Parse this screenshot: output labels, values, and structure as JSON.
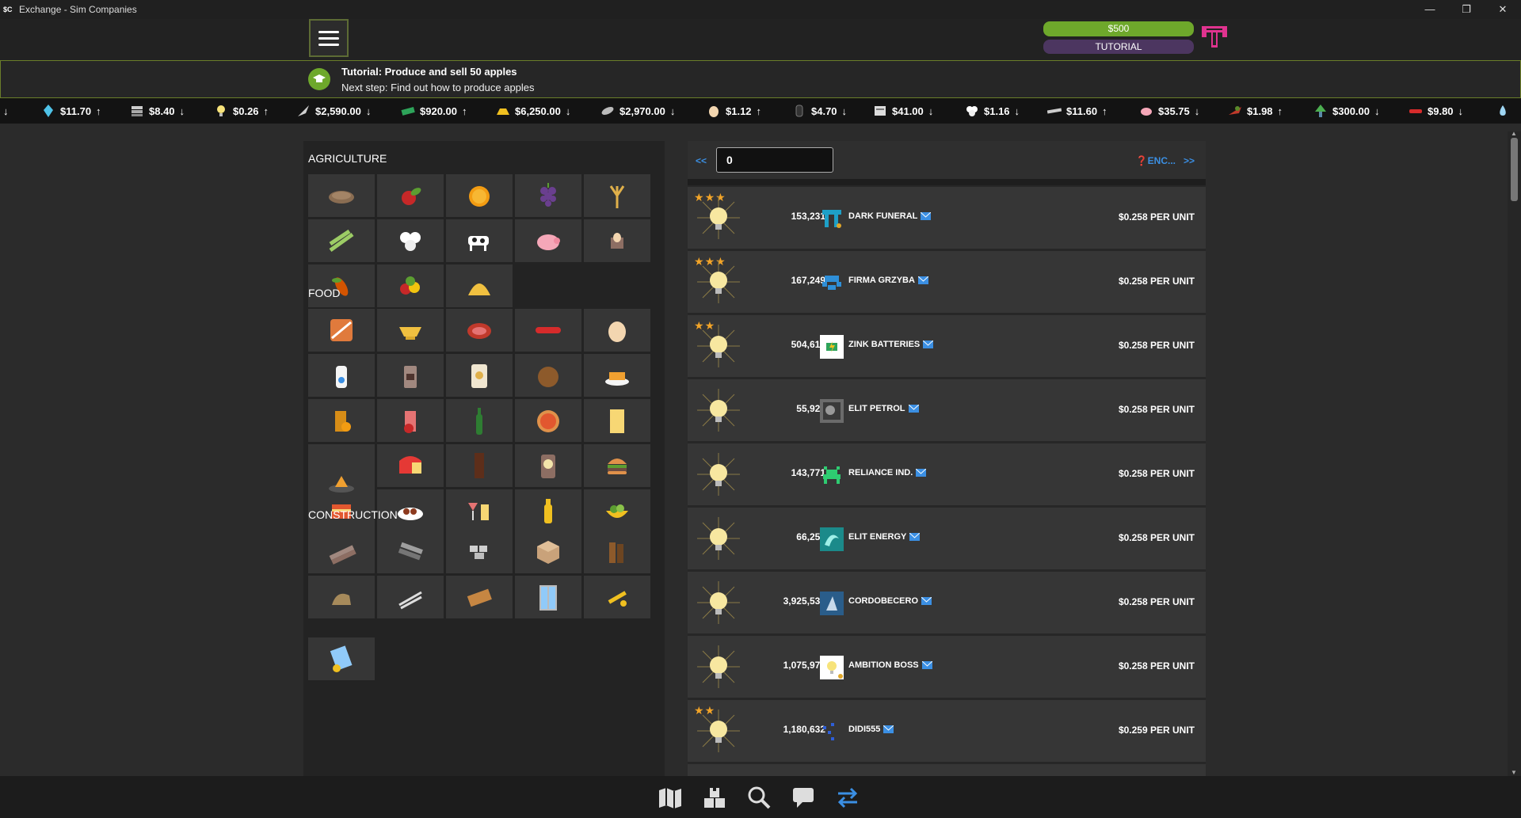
{
  "window": {
    "app_icon": "$C",
    "title": "Exchange - Sim Companies",
    "controls": [
      "—",
      "❐",
      "✕"
    ]
  },
  "header": {
    "money": "$500",
    "tutorial_label": "TUTORIAL",
    "logo": "company-logo-pink-T"
  },
  "tutorial": {
    "title": "Tutorial: Produce and sell 50 apples",
    "step": "Next step: Find out how to produce apples"
  },
  "ticker": [
    {
      "icon": "arrow",
      "price": "",
      "dir": "↓"
    },
    {
      "icon": "crystal-icon",
      "price": "$11.70",
      "dir": "↑"
    },
    {
      "icon": "silicon-icon",
      "price": "$8.40",
      "dir": "↓"
    },
    {
      "icon": "power-icon",
      "price": "$0.26",
      "dir": "↑"
    },
    {
      "icon": "rocket-icon",
      "price": "$2,590.00",
      "dir": "↓"
    },
    {
      "icon": "cash-icon",
      "price": "$920.00",
      "dir": "↑"
    },
    {
      "icon": "gold-icon",
      "price": "$6,250.00",
      "dir": "↓"
    },
    {
      "icon": "jet-icon",
      "price": "$2,970.00",
      "dir": "↓"
    },
    {
      "icon": "egg-icon",
      "price": "$1.12",
      "dir": "↑"
    },
    {
      "icon": "seeds-icon",
      "price": "$4.70",
      "dir": "↓"
    },
    {
      "icon": "box-icon",
      "price": "$41.00",
      "dir": "↓"
    },
    {
      "icon": "cotton-icon",
      "price": "$1.16",
      "dir": "↓"
    },
    {
      "icon": "steel-icon",
      "price": "$11.60",
      "dir": "↑"
    },
    {
      "icon": "pig-icon",
      "price": "$35.75",
      "dir": "↓"
    },
    {
      "icon": "plane-icon",
      "price": "$1.98",
      "dir": "↑"
    },
    {
      "icon": "tree-icon",
      "price": "$300.00",
      "dir": "↓"
    },
    {
      "icon": "sausage-icon",
      "price": "$9.80",
      "dir": "↓"
    },
    {
      "icon": "water-icon",
      "price": "",
      "dir": ""
    }
  ],
  "categories": [
    {
      "name": "AGRICULTURE",
      "items": [
        "seeds-icon",
        "apple-icon",
        "orange-icon",
        "grapes-icon",
        "wheat-icon",
        "sugarcane-icon",
        "cotton-icon",
        "cow-icon",
        "pig-icon",
        "eggs-icon",
        "cocoa-icon",
        "vegetables-icon",
        "straw-icon"
      ]
    },
    {
      "name": "FOOD",
      "items": [
        "bread-icon",
        "sauce-icon",
        "steak-icon",
        "sausages-icon",
        "egg-icon",
        "milk-icon",
        "coffee-icon",
        "flour-icon",
        "pie-icon",
        "fries-icon",
        "orange-juice-icon",
        "apple-juice-icon",
        "ginger-beer-icon",
        "pizza-icon",
        "juice-box-icon",
        "butter-icon",
        "cheese-icon",
        "chocolate-icon",
        "coffee-beans-icon",
        "burger-icon",
        "lasagna-icon",
        "meatballs-icon",
        "cocktails-icon",
        "cooking-oil-icon",
        "salad-icon",
        "samosa-icon"
      ]
    },
    {
      "name": "CONSTRUCTION",
      "items": [
        "planks-icon",
        "steel-bars-icon",
        "bricks-icon",
        "cement-icon",
        "wood-icon",
        "clay-icon",
        "reinforced-concrete-icon",
        "board-icon",
        "windows-icon",
        "tools-icon",
        "glass-icon"
      ]
    }
  ],
  "market": {
    "prev_label": "<<",
    "next_label": ">>",
    "qty_value": "0",
    "enc_label": "ENC...",
    "listings": [
      {
        "stars": 3,
        "qty": "153,231",
        "company": "DARK FUNERAL",
        "logo": "teal-tt-logo",
        "price": "$0.258 PER UNIT"
      },
      {
        "stars": 3,
        "qty": "167,249",
        "company": "FIRMA GRZYBA",
        "logo": "blue-pixel-logo",
        "price": "$0.258 PER UNIT"
      },
      {
        "stars": 2,
        "qty": "504,614",
        "company": "ZINK BATTERIES",
        "logo": "battery-logo",
        "price": "$0.258 PER UNIT"
      },
      {
        "stars": 0,
        "qty": "55,926",
        "company": "ELIT PETROL",
        "logo": "photo-logo",
        "price": "$0.258 PER UNIT"
      },
      {
        "stars": 0,
        "qty": "143,771",
        "company": "RELIANCE IND.",
        "logo": "green-invader-logo",
        "price": "$0.258 PER UNIT"
      },
      {
        "stars": 0,
        "qty": "66,256",
        "company": "ELIT ENERGY",
        "logo": "wave-logo",
        "price": "$0.258 PER UNIT"
      },
      {
        "stars": 0,
        "qty": "3,925,532",
        "company": "CORDOBECERO",
        "logo": "photo-logo-2",
        "price": "$0.258 PER UNIT"
      },
      {
        "stars": 0,
        "qty": "1,075,977",
        "company": "AMBITION BOSS",
        "logo": "bulb-logo",
        "price": "$0.258 PER UNIT"
      },
      {
        "stars": 2,
        "qty": "1,180,632",
        "company": "DIDI555",
        "logo": "dots-logo",
        "price": "$0.259 PER UNIT"
      }
    ]
  },
  "bottom_nav": [
    "map-icon",
    "warehouse-icon",
    "search-icon",
    "chat-icon",
    "exchange-icon"
  ],
  "colors": {
    "accent_green": "#6ea82b",
    "link_blue": "#3b8fe3",
    "star": "#f2a428",
    "tutorial_purple": "#4c3660"
  }
}
